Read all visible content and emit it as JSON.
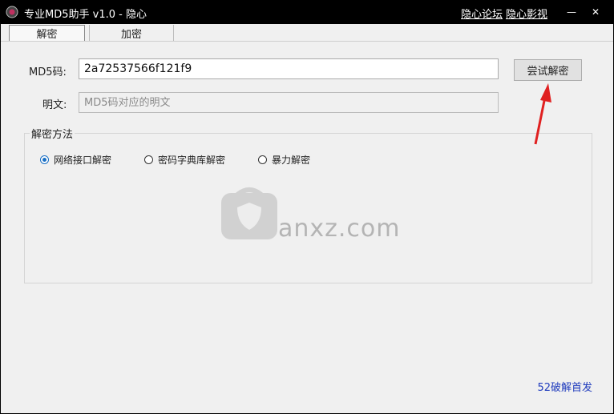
{
  "window": {
    "title": "专业MD5助手 v1.0 - 隐心",
    "links": [
      "隐心论坛",
      "隐心影视"
    ],
    "controls": {
      "minimize": "—",
      "close": "✕"
    }
  },
  "tabs": [
    {
      "label": "解密",
      "active": true
    },
    {
      "label": "加密",
      "active": false
    }
  ],
  "form": {
    "md5_label": "MD5码:",
    "md5_value": "2a72537566f121f9",
    "plain_label": "明文:",
    "plain_placeholder": "MD5码对应的明文",
    "decrypt_button": "尝试解密"
  },
  "method": {
    "title": "解密方法",
    "options": [
      {
        "label": "网络接口解密",
        "selected": true
      },
      {
        "label": "密码字典库解密",
        "selected": false
      },
      {
        "label": "暴力解密",
        "selected": false
      }
    ]
  },
  "watermark": {
    "text": "anxz.com"
  },
  "footer": {
    "link": "52破解首发"
  },
  "colors": {
    "arrow": "#e02020",
    "link": "#1f3bbd",
    "radio_accent": "#1a6fc4"
  }
}
